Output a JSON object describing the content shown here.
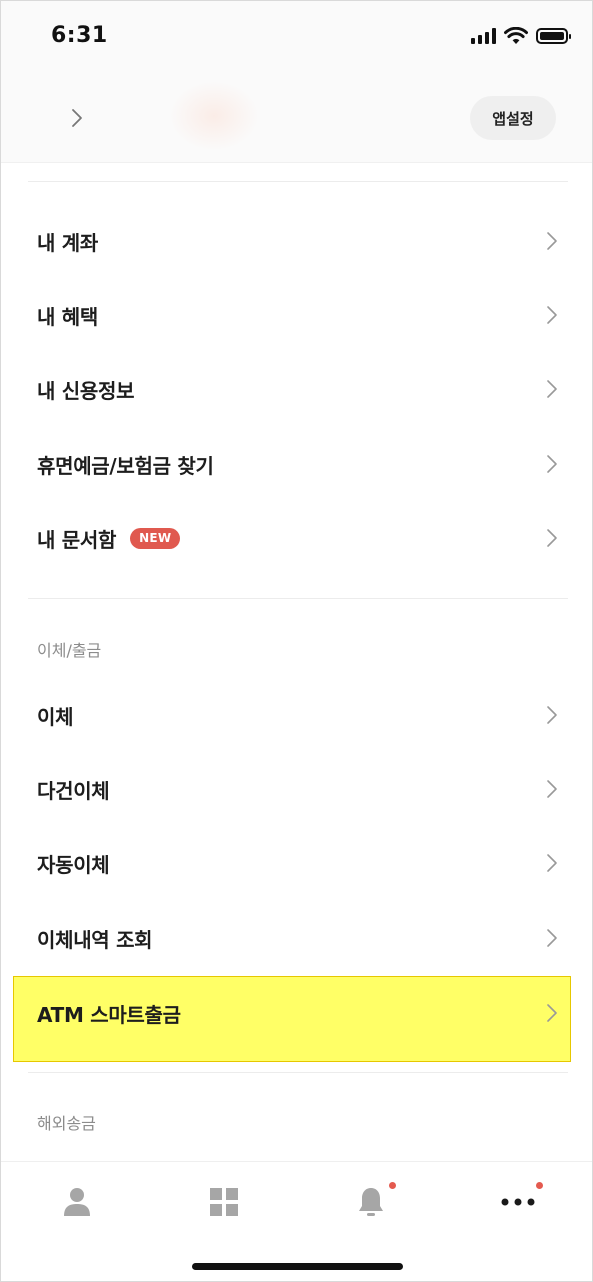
{
  "status_bar": {
    "time": "6:31",
    "signal_icon": "signal-bars-icon",
    "wifi_icon": "wifi-icon",
    "battery_icon": "battery-icon"
  },
  "header": {
    "profile_chevron_icon": "chevron-right-icon",
    "app_settings_label": "앱설정"
  },
  "account_menu": [
    {
      "label": "내 계좌"
    },
    {
      "label": "내 혜택"
    },
    {
      "label": "내 신용정보"
    },
    {
      "label": "휴면예금/보험금 찾기"
    },
    {
      "label": "내 문서함",
      "badge": "NEW"
    }
  ],
  "transfer_section": {
    "title": "이체/출금",
    "items": [
      {
        "label": "이체"
      },
      {
        "label": "다건이체"
      },
      {
        "label": "자동이체"
      },
      {
        "label": "이체내역 조회"
      },
      {
        "label": "ATM 스마트출금",
        "highlighted": true
      }
    ]
  },
  "overseas_section": {
    "title": "해외송금"
  },
  "tab_bar": {
    "tabs": [
      {
        "icon": "person-icon",
        "has_dot": false
      },
      {
        "icon": "grid-icon",
        "has_dot": false
      },
      {
        "icon": "bell-icon",
        "has_dot": true
      },
      {
        "icon": "more-dots-icon",
        "has_dot": true
      }
    ]
  },
  "colors": {
    "badge": "#e0594f",
    "highlight": "#ffff66",
    "notification_dot": "#e45a4f",
    "icon_gray": "#a6a6a6"
  }
}
